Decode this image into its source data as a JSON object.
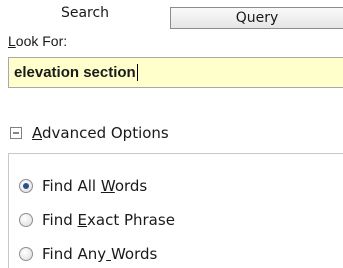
{
  "tabs": {
    "search_label": "Search",
    "query_label": "Query"
  },
  "lookfor": {
    "label_accel": "L",
    "label_rest": "ook For:",
    "value": "elevation section",
    "field_background": "#ffffcc"
  },
  "advanced": {
    "accel": "A",
    "rest": "dvanced Options",
    "expanded": true
  },
  "options": [
    {
      "before": "Find All ",
      "accel": "W",
      "after": "ords",
      "selected": true
    },
    {
      "before": "Find ",
      "accel": "E",
      "after": "xact Phrase",
      "selected": false
    },
    {
      "before": "Find Any",
      "accel": " ",
      "after": "Words",
      "selected": false
    }
  ],
  "colors": {
    "radio_selected": "#2a4f8f"
  }
}
